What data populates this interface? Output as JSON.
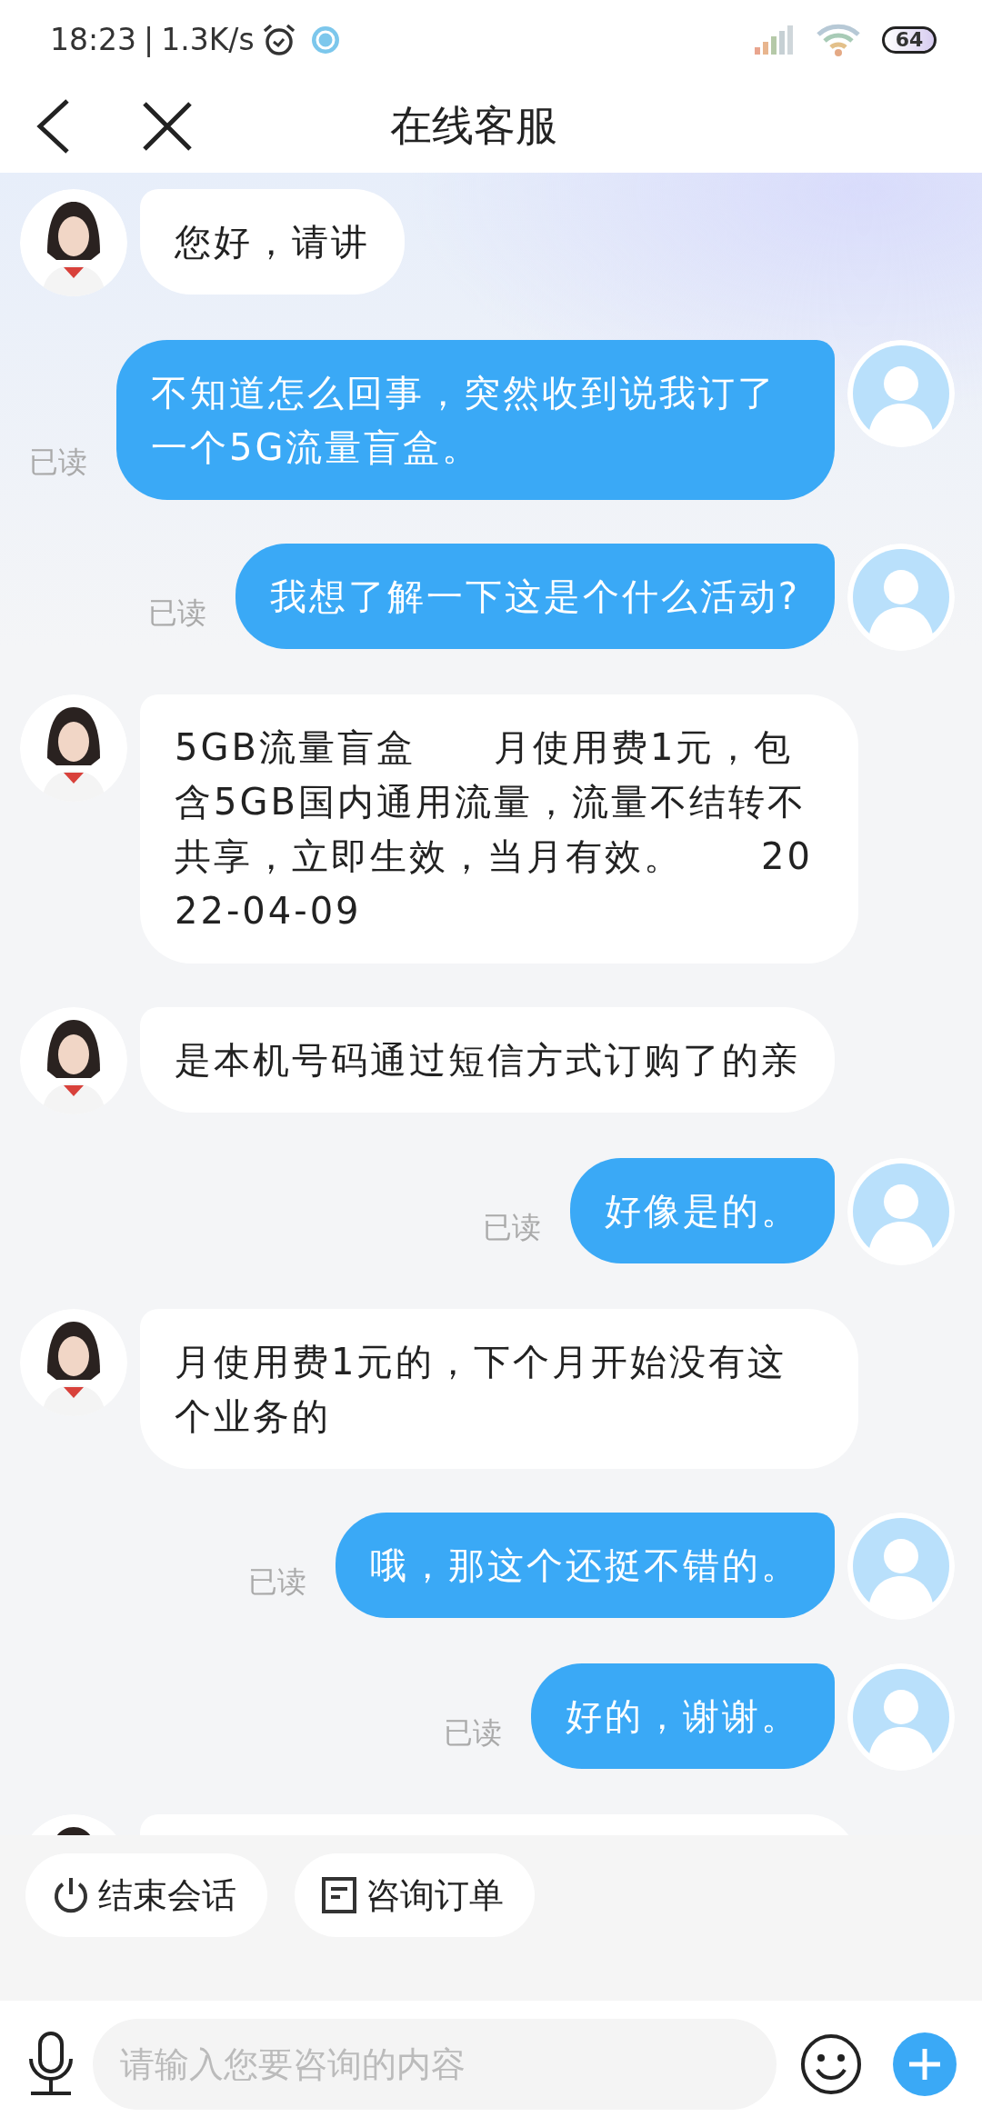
{
  "status_bar": {
    "time": "18:23",
    "separator": "|",
    "speed": "1.3K/s",
    "battery": "64"
  },
  "header": {
    "title": "在线客服"
  },
  "messages": [
    {
      "kind": "agent",
      "text": "您好，请讲"
    },
    {
      "kind": "user",
      "text": "不知道怎么回事，突然收到说我订了一个5G流量盲盒。",
      "read_label": "已读"
    },
    {
      "kind": "user",
      "text": "我想了解一下这是个什么活动?",
      "read_label": "已读"
    },
    {
      "kind": "agent",
      "text": "5GB流量盲盒　　月使用费1元，包含5GB国内通用流量，流量不结转不共享，立即生效，当月有效。　　2022-04-09"
    },
    {
      "kind": "agent",
      "text": "是本机号码通过短信方式订购了的亲"
    },
    {
      "kind": "user",
      "text": "好像是的。",
      "read_label": "已读"
    },
    {
      "kind": "agent",
      "text": "月使用费1元的，下个月开始没有这个业务的"
    },
    {
      "kind": "user",
      "text": "哦，那这个还挺不错的。",
      "read_label": "已读"
    },
    {
      "kind": "user",
      "text": "好的，谢谢。",
      "read_label": "已读"
    },
    {
      "kind": "agent"
    }
  ],
  "quick_actions": [
    {
      "label": "结束会话"
    },
    {
      "label": "咨询订单"
    }
  ],
  "input": {
    "placeholder": "请输入您要咨询的内容"
  }
}
